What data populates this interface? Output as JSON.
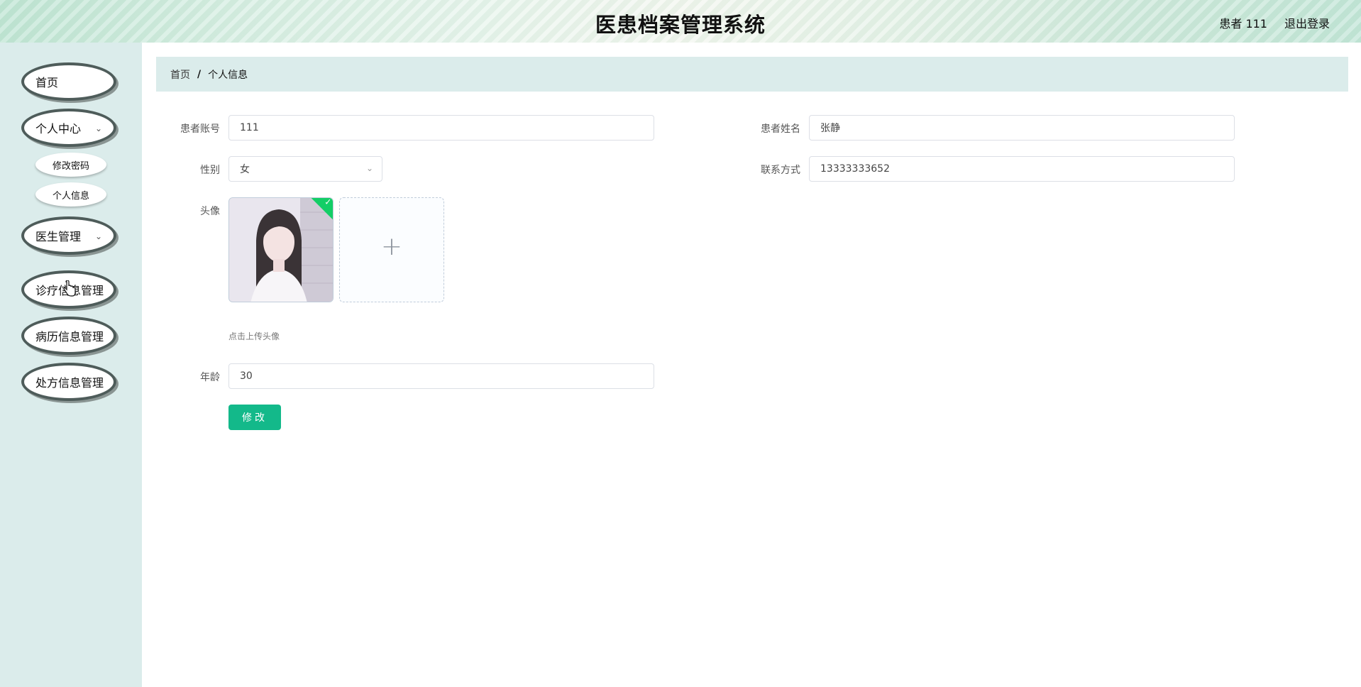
{
  "header": {
    "title": "医患档案管理系统",
    "user": "患者 111",
    "logout": "退出登录"
  },
  "sidebar": {
    "items": [
      {
        "label": "首页"
      },
      {
        "label": "个人中心",
        "expandable": true
      },
      {
        "label": "医生管理",
        "expandable": true
      },
      {
        "label": "诊疗信息管理"
      },
      {
        "label": "病历信息管理"
      },
      {
        "label": "处方信息管理"
      }
    ],
    "sub_items": [
      {
        "label": "修改密码"
      },
      {
        "label": "个人信息"
      }
    ]
  },
  "breadcrumb": {
    "home": "首页",
    "separator": "/",
    "current": "个人信息"
  },
  "form": {
    "account_label": "患者账号",
    "account_value": "111",
    "name_label": "患者姓名",
    "name_value": "张静",
    "gender_label": "性别",
    "gender_value": "女",
    "phone_label": "联系方式",
    "phone_value": "13333333652",
    "avatar_label": "头像",
    "avatar_tip": "点击上传头像",
    "age_label": "年龄",
    "age_value": "30",
    "submit_label": "修改"
  },
  "icons": {
    "dropdown": "chevron-down-icon",
    "upload": "plus-icon",
    "success": "check-icon"
  },
  "colors": {
    "primary_button": "#13b98a",
    "sidebar_bg": "#dbeceb",
    "success_badge": "#13ce66"
  }
}
